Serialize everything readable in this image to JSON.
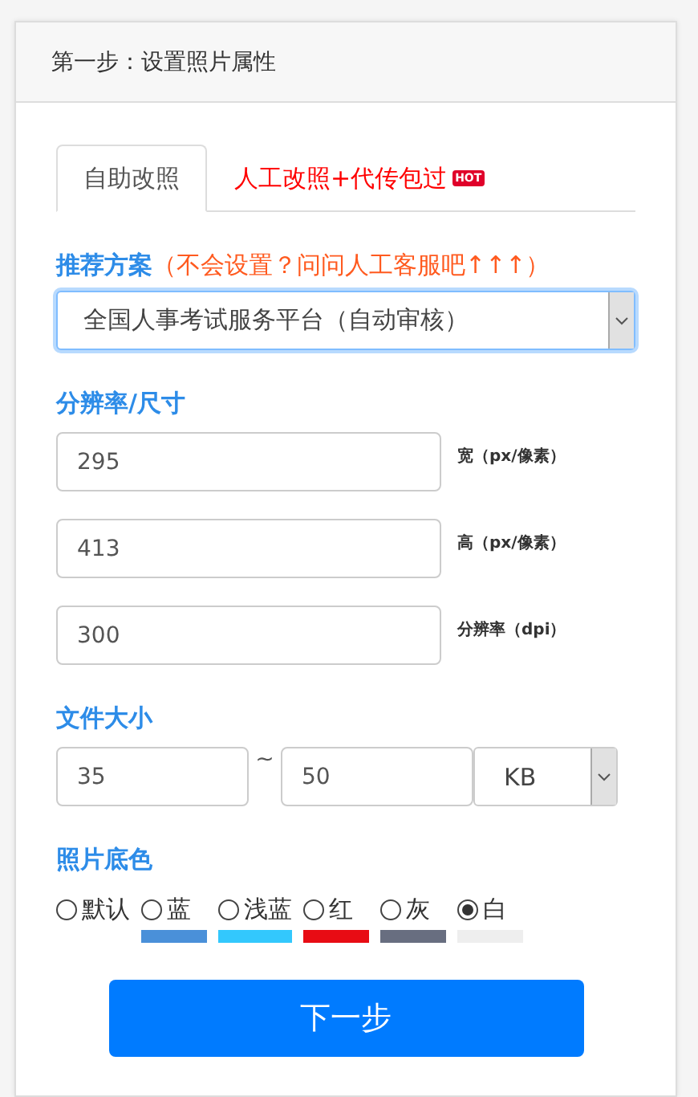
{
  "panel": {
    "title": "第一步：设置照片属性"
  },
  "tabs": [
    {
      "label": "自助改照",
      "selected": true
    },
    {
      "label": "人工改照+代传包过",
      "selected": false,
      "badge": "HOT"
    }
  ],
  "plan": {
    "label": "推荐方案",
    "hint": "（不会设置？问问人工客服吧↑↑↑）",
    "value": "全国人事考试服务平台（自动审核）"
  },
  "size": {
    "label": "分辨率/尺寸",
    "fields": [
      {
        "value": "295",
        "unit": "宽（px/像素）"
      },
      {
        "value": "413",
        "unit": "高（px/像素）"
      },
      {
        "value": "300",
        "unit": "分辨率（dpi）"
      }
    ]
  },
  "file_size": {
    "label": "文件大小",
    "min": "35",
    "separator": "~",
    "max": "50",
    "unit": "KB"
  },
  "background": {
    "label": "照片底色",
    "options": [
      {
        "label": "默认",
        "selected": false
      },
      {
        "label": "蓝",
        "selected": false,
        "color": "#4a90d9"
      },
      {
        "label": "浅蓝",
        "selected": false,
        "color": "#33c8fd"
      },
      {
        "label": "红",
        "selected": false,
        "color": "#e80c14"
      },
      {
        "label": "灰",
        "selected": false,
        "color": "#686e80"
      },
      {
        "label": "白",
        "selected": true,
        "color": "#eeeeee"
      }
    ]
  },
  "next_button": "下一步"
}
